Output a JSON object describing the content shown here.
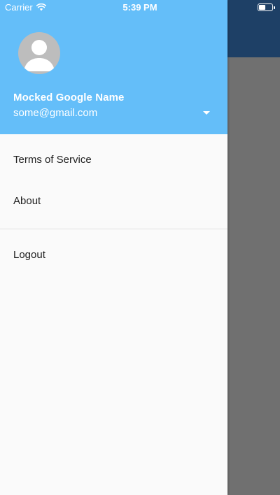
{
  "status_bar": {
    "carrier": "Carrier",
    "time": "5:39 PM",
    "battery_level": 0.5
  },
  "drawer": {
    "header": {
      "account_name": "Mocked Google Name",
      "account_email": "some@gmail.com",
      "background_color": "#64bef9",
      "avatar_icon": "person-icon",
      "dropdown_icon": "caret-down-icon"
    },
    "items": [
      {
        "label": "Terms of Service"
      },
      {
        "label": "About"
      }
    ],
    "logout_label": "Logout"
  },
  "app": {
    "appbar_color": "#1e4066",
    "scrim_color": "#707070"
  }
}
